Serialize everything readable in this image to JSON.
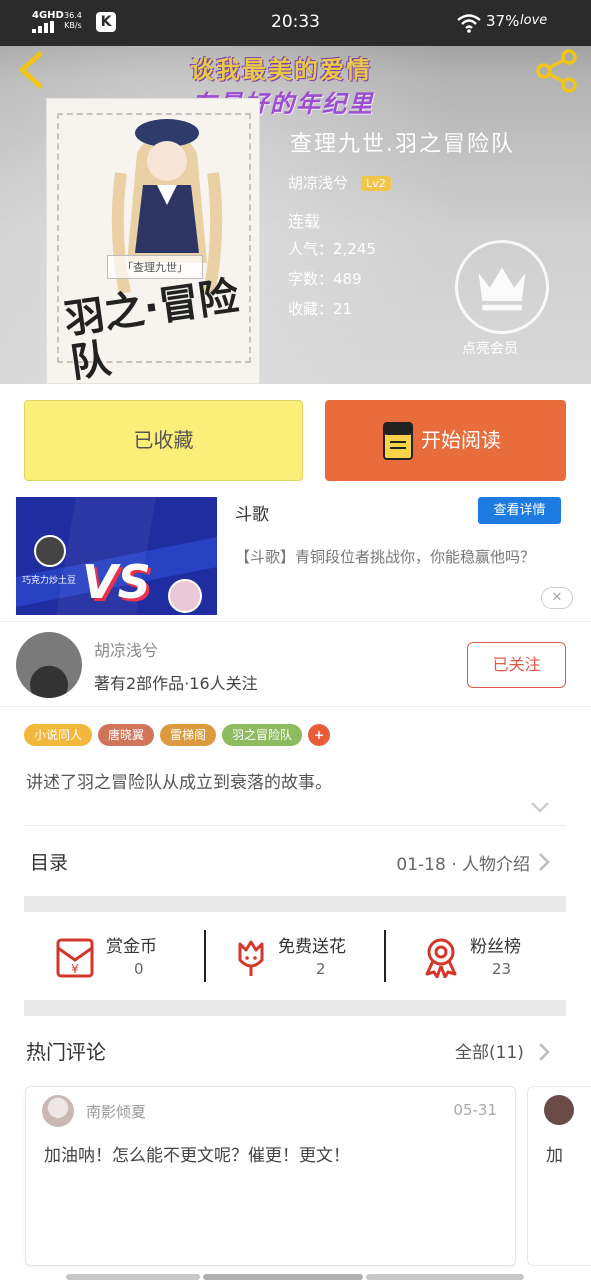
{
  "status_bar": {
    "network": "4GHD",
    "speed": "36.4\nKB/s",
    "app_badge": "K",
    "time": "20:33",
    "battery": "37%",
    "decor": "love"
  },
  "header": {
    "promo_line1": "谈我最美的爱情",
    "promo_line2": "在最好的年纪里",
    "book_title": "查理九世.羽之冒险队",
    "author": "胡凉浅兮",
    "author_level": "Lv2",
    "status": "连载",
    "popularity": "人气：2,245",
    "word_count": "字数：489",
    "favorites": "收藏：21",
    "vip_label": "点亮会员"
  },
  "cover": {
    "tag": "「查理九世」",
    "title": "羽之·冒险队"
  },
  "actions": {
    "favorite_label": "已收藏",
    "read_label": "开始阅读"
  },
  "ad": {
    "title": "斗歌",
    "detail_label": "查看详情",
    "description": "【斗歌】青铜段位者挑战你，你能稳赢他吗？",
    "close": "✕",
    "image_vs": "VS",
    "image_name": "巧克力炒土豆"
  },
  "author_card": {
    "name": "胡凉浅兮",
    "sub": "著有2部作品·16人关注",
    "follow_label": "已关注"
  },
  "tags": [
    {
      "label": "小说同人",
      "color": "#f3b73b"
    },
    {
      "label": "唐晓翼",
      "color": "#d2745a"
    },
    {
      "label": "雷梯阁",
      "color": "#dd9a3c"
    },
    {
      "label": "羽之冒险队",
      "color": "#8dbb5f"
    }
  ],
  "tag_plus": "+",
  "summary": "讲述了羽之冒险队从成立到衰落的故事。",
  "toc": {
    "label": "目录",
    "chapter": "01-18 · 人物介绍"
  },
  "stats": [
    {
      "label": "赏金币",
      "value": "0",
      "icon": "red-envelope-icon"
    },
    {
      "label": "免费送花",
      "value": "2",
      "icon": "flower-icon"
    },
    {
      "label": "粉丝榜",
      "value": "23",
      "icon": "ribbon-medal-icon"
    }
  ],
  "comments": {
    "section_title": "热门评论",
    "all_label": "全部(11)",
    "items": [
      {
        "user": "南影倾夏",
        "date": "05-31",
        "text": "加油呐！怎么能不更文呢？催更！更文！"
      },
      {
        "text": "加"
      }
    ]
  },
  "colors": {
    "accent_orange": "#e86c3c",
    "fav_yellow": "#fbef79",
    "follow_red": "#e05a49",
    "detail_blue": "#1e7be2"
  }
}
